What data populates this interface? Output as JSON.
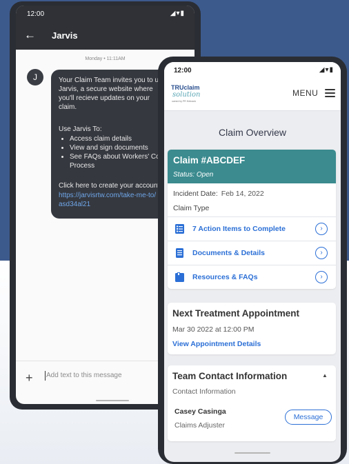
{
  "phone_sms": {
    "status_time": "12:00",
    "status_icons": "◢▾▮",
    "back_icon": "arrow-left",
    "title": "Jarvis",
    "date_label": "Monday • 11:11AM",
    "avatar_letter": "J",
    "message": {
      "intro": "Your Claim Team invites you to u\nJarvis, a secure website where\nyou'll recieve updates on your\nclaim.",
      "use_heading": "Use Jarvis To:",
      "bullets": [
        "Access claim details",
        "View and sign documents",
        "See FAQs about Workers' Con\nProcess"
      ],
      "click_text": "Click here to create your account",
      "link": "https://jarvisrtw.com/take-me-to/\nasd34al21"
    },
    "compose_plus": "+",
    "compose_placeholder": "Add text to this message"
  },
  "phone_app": {
    "status_time": "12:00",
    "status_icons": "◢▾▮",
    "logo": {
      "line1": "TRUclaim",
      "line2": "solution",
      "line3": "owned by PR Hebrank"
    },
    "menu_label": "MENU",
    "page_title": "Claim Overview",
    "claim": {
      "number": "Claim #ABCDEF",
      "status": "Status: Open",
      "incident_label": "Incident Date:",
      "incident_date": "Feb 14, 2022",
      "claim_type_label": "Claim Type",
      "actions": [
        {
          "label": "7 Action Items to Complete",
          "icon": "checklist-icon"
        },
        {
          "label": "Documents & Details",
          "icon": "document-icon"
        },
        {
          "label": "Resources & FAQs",
          "icon": "folder-icon"
        }
      ]
    },
    "appointment": {
      "title": "Next Treatment Appointment",
      "datetime": "Mar 30 2022 at 12:00 PM",
      "link": "View Appointment Details"
    },
    "team": {
      "title": "Team Contact Information",
      "subtitle": "Contact Information",
      "name": "Casey Casinga",
      "role": "Claims Adjuster",
      "message_button": "Message"
    }
  },
  "colors": {
    "background_blue": "#3d5a8c",
    "claim_header_teal": "#3b8b8f",
    "link_blue": "#2b6fd6",
    "sms_bubble": "#35383f"
  }
}
